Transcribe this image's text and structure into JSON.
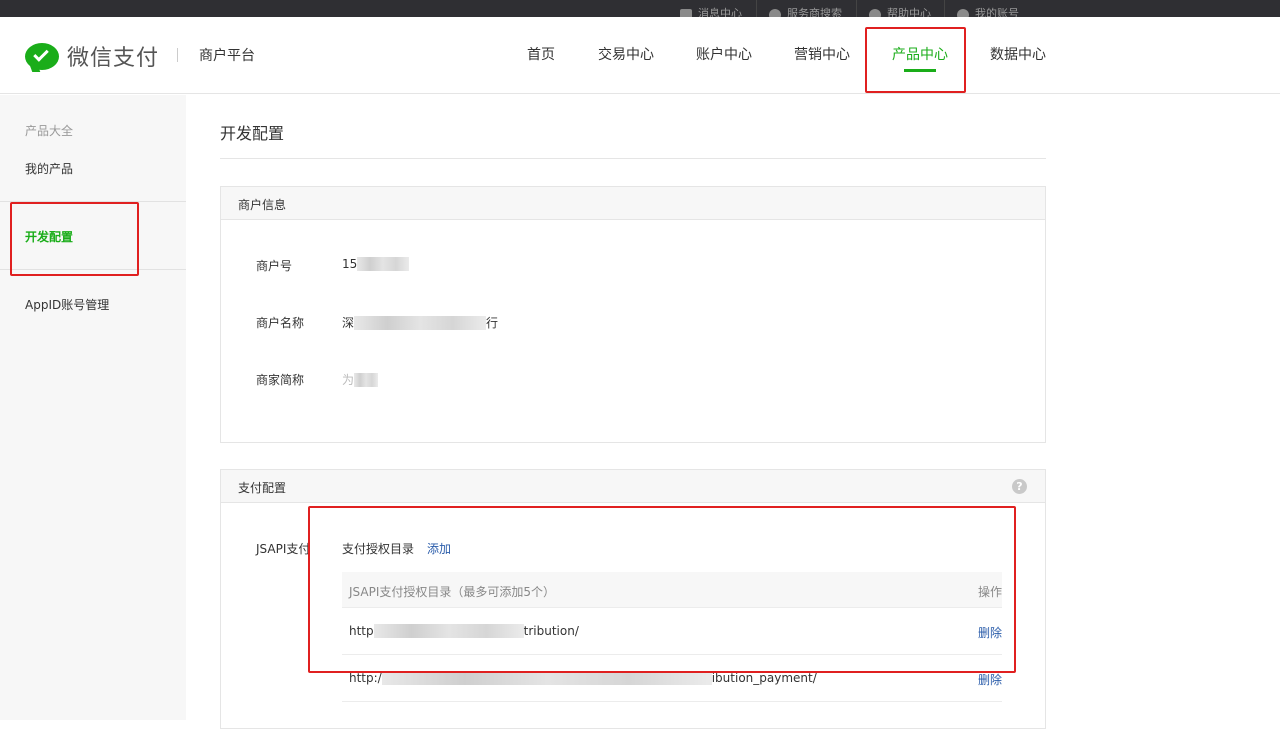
{
  "topbar": {
    "items": [
      {
        "label": "消息中心",
        "icon": "envelope-icon"
      },
      {
        "label": "服务商搜索",
        "icon": "search-circle-icon"
      },
      {
        "label": "帮助中心",
        "icon": "help-icon"
      },
      {
        "label": "我的账号",
        "icon": "user-icon"
      }
    ]
  },
  "header": {
    "logo_text": "微信支付",
    "platform": "商户平台",
    "nav": [
      "首页",
      "交易中心",
      "账户中心",
      "营销中心",
      "产品中心",
      "数据中心"
    ],
    "active_nav": "产品中心"
  },
  "sidebar": {
    "group": "产品大全",
    "items": [
      "我的产品",
      "开发配置",
      "AppID账号管理"
    ],
    "active": "开发配置"
  },
  "main": {
    "page_title": "开发配置",
    "merchant_panel": {
      "title": "商户信息",
      "rows": [
        {
          "label": "商户号",
          "value_prefix": "15",
          "value_suffix": ""
        },
        {
          "label": "商户名称",
          "value_prefix": "深",
          "value_suffix": "行"
        },
        {
          "label": "商家简称",
          "value_prefix": "为",
          "value_suffix": ""
        }
      ]
    },
    "payment_panel": {
      "title": "支付配置",
      "help": "?",
      "jsapi_label": "JSAPI支付",
      "dir_title": "支付授权目录",
      "add_label": "添加",
      "table_header": "JSAPI支付授权目录（最多可添加5个）",
      "action_header": "操作",
      "rows": [
        {
          "url_prefix": "http",
          "url_suffix": "tribution/",
          "action": "删除"
        },
        {
          "url_prefix": "http:/",
          "url_suffix": "ibution_payment/",
          "action": "删除"
        }
      ]
    }
  },
  "colors": {
    "brand_green": "#1aad19",
    "link_blue": "#2a5caa",
    "highlight_red": "#e02020"
  }
}
